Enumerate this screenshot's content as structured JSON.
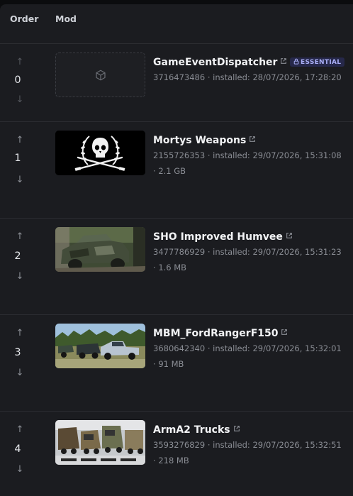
{
  "table": {
    "col_order": "Order",
    "col_mod": "Mod"
  },
  "rows": [
    {
      "order": "0",
      "name": "GameEventDispatcher",
      "badge": "ESSENTIAL",
      "details": "3716473486",
      "installed": "installed: 28/07/2026, 17:28:20",
      "size": "",
      "thumb": "placeholder-cube-icon"
    },
    {
      "order": "1",
      "name": "Mortys Weapons",
      "details": "2155726353",
      "installed": "installed: 29/07/2026, 15:31:08",
      "size": "2.1 GB",
      "thumb": "laurel-skull-rifles-emblem"
    },
    {
      "order": "2",
      "name": "SHO Improved Humvee",
      "details": "3477786929",
      "installed": "installed: 29/07/2026, 15:31:23",
      "size": "1.6 MB",
      "thumb": "camo-humvee-photo"
    },
    {
      "order": "3",
      "name": "MBM_FordRangerF150",
      "details": "3680642340",
      "installed": "installed: 29/07/2026, 15:32:01",
      "size": "91 MB",
      "thumb": "pickup-trucks-field-photo"
    },
    {
      "order": "4",
      "name": "ArmA2 Trucks",
      "details": "3593276829",
      "installed": "installed: 29/07/2026, 15:32:51",
      "size": "218 MB",
      "thumb": "military-trucks-collage"
    }
  ],
  "colors": {
    "panel": "#1b1c20",
    "divider": "#2c2d32",
    "badge_bg": "#26284a",
    "badge_text": "#a9aef5",
    "muted_text": "#8a8d94"
  }
}
